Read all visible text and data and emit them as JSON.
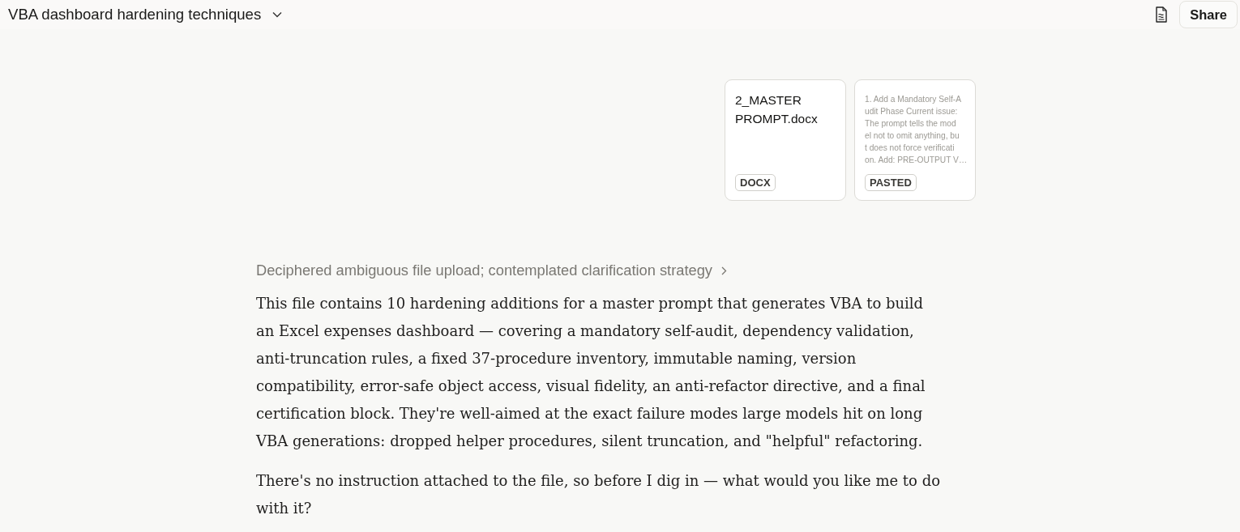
{
  "header": {
    "title": "VBA dashboard hardening techniques",
    "share_label": "Share"
  },
  "attachments": [
    {
      "kind": "file",
      "name": "2_MASTER PROMPT.docx",
      "tag": "DOCX"
    },
    {
      "kind": "pasted",
      "preview_lines": [
        "1. Add a Mandatory Self-A",
        "udit Phase Current issue:",
        "The prompt tells the mod",
        "el not to omit anything, bu",
        "t does not force verificati",
        "on. Add: PRE-OUTPUT V…"
      ],
      "tag": "PASTED"
    }
  ],
  "response": {
    "thinking_summary": "Deciphered ambiguous file upload; contemplated clarification strategy",
    "paragraphs": [
      "This file contains 10 hardening additions for a master prompt that generates VBA to build an Excel expenses dashboard — covering a mandatory self-audit, dependency validation, anti-truncation rules, a fixed 37-procedure inventory, immutable naming, version compatibility, error-safe object access, visual fidelity, an anti-refactor directive, and a final certification block. They're well-aimed at the exact failure modes large models hit on long VBA generations: dropped helper procedures, silent truncation, and \"helpful\" refactoring.",
      "There's no instruction attached to the file, so before I dig in — what would you like me to do with it?"
    ]
  }
}
